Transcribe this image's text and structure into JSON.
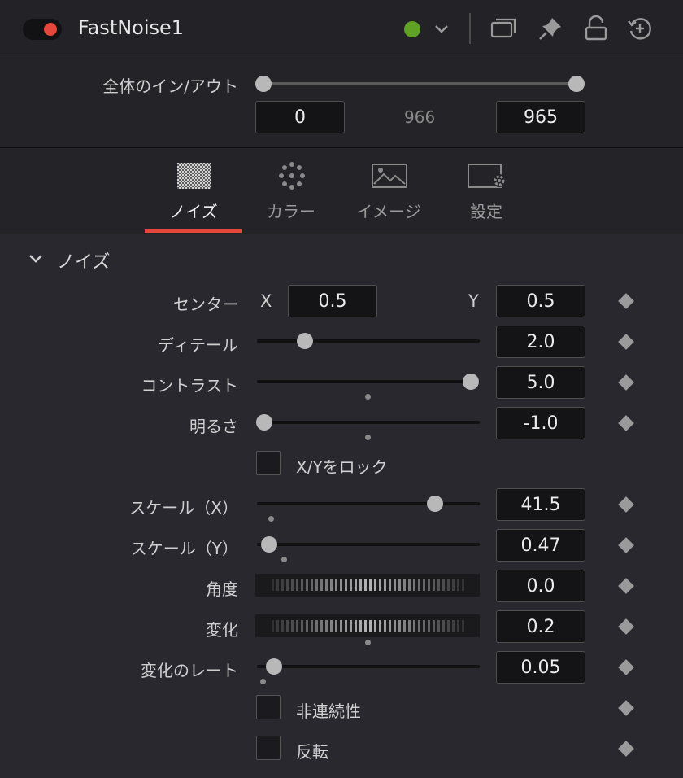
{
  "header": {
    "title": "FastNoise1",
    "colors": {
      "enabled_dot": "#e5473a",
      "node_color": "#5fa224"
    },
    "icons": [
      "enable-toggle",
      "color-picker-chevron-icon",
      "versions-icon",
      "pin-icon",
      "lock-icon",
      "reset-icon"
    ]
  },
  "inout": {
    "label": "全体のイン/アウト",
    "in_value": "0",
    "duration": "966",
    "out_value": "965"
  },
  "tabs": [
    {
      "label": "ノイズ",
      "icon": "noise-icon",
      "active": true
    },
    {
      "label": "カラー",
      "icon": "color-dots-icon",
      "active": false
    },
    {
      "label": "イメージ",
      "icon": "image-icon",
      "active": false
    },
    {
      "label": "設定",
      "icon": "settings-icon",
      "active": false
    }
  ],
  "section": {
    "title": "ノイズ"
  },
  "controls": {
    "center": {
      "label": "センター",
      "x_label": "X",
      "x_value": "0.5",
      "y_label": "Y",
      "y_value": "0.5"
    },
    "detail": {
      "label": "ディテール",
      "value": "2.0"
    },
    "contrast": {
      "label": "コントラスト",
      "value": "5.0"
    },
    "brightness": {
      "label": "明るさ",
      "value": "-1.0"
    },
    "lock_xy": {
      "label": "X/Yをロック",
      "checked": false
    },
    "scale_x": {
      "label": "スケール（X）",
      "value": "41.5"
    },
    "scale_y": {
      "label": "スケール（Y）",
      "value": "0.47"
    },
    "angle": {
      "label": "角度",
      "value": "0.0"
    },
    "seethe": {
      "label": "変化",
      "value": "0.2"
    },
    "seethe_rate": {
      "label": "変化のレート",
      "value": "0.05"
    },
    "discontinuous": {
      "label": "非連続性",
      "checked": false
    },
    "invert": {
      "label": "反転",
      "checked": false
    }
  }
}
